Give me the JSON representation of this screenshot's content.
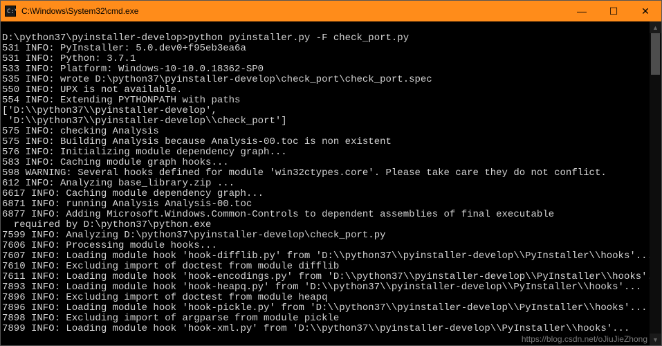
{
  "window": {
    "title": "C:\\Windows\\System32\\cmd.exe",
    "controls": {
      "minimize": "—",
      "maximize": "☐",
      "close": "✕"
    }
  },
  "prompt": "D:\\python37\\pyinstaller-develop>",
  "command": "python pyinstaller.py -F check_port.py",
  "lines": [
    "531 INFO: PyInstaller: 5.0.dev0+f95eb3ea6a",
    "531 INFO: Python: 3.7.1",
    "533 INFO: Platform: Windows-10-10.0.18362-SP0",
    "535 INFO: wrote D:\\python37\\pyinstaller-develop\\check_port\\check_port.spec",
    "550 INFO: UPX is not available.",
    "554 INFO: Extending PYTHONPATH with paths",
    "['D:\\\\python37\\\\pyinstaller-develop',",
    " 'D:\\\\python37\\\\pyinstaller-develop\\\\check_port']",
    "575 INFO: checking Analysis",
    "575 INFO: Building Analysis because Analysis-00.toc is non existent",
    "576 INFO: Initializing module dependency graph...",
    "583 INFO: Caching module graph hooks...",
    "598 WARNING: Several hooks defined for module 'win32ctypes.core'. Please take care they do not conflict.",
    "612 INFO: Analyzing base_library.zip ...",
    "6617 INFO: Caching module dependency graph...",
    "6871 INFO: running Analysis Analysis-00.toc",
    "6877 INFO: Adding Microsoft.Windows.Common-Controls to dependent assemblies of final executable",
    "  required by D:\\python37\\python.exe",
    "7599 INFO: Analyzing D:\\python37\\pyinstaller-develop\\check_port.py",
    "7606 INFO: Processing module hooks...",
    "7607 INFO: Loading module hook 'hook-difflib.py' from 'D:\\\\python37\\\\pyinstaller-develop\\\\PyInstaller\\\\hooks'...",
    "7610 INFO: Excluding import of doctest from module difflib",
    "7611 INFO: Loading module hook 'hook-encodings.py' from 'D:\\\\python37\\\\pyinstaller-develop\\\\PyInstaller\\\\hooks'...",
    "7893 INFO: Loading module hook 'hook-heapq.py' from 'D:\\\\python37\\\\pyinstaller-develop\\\\PyInstaller\\\\hooks'...",
    "7896 INFO: Excluding import of doctest from module heapq",
    "7896 INFO: Loading module hook 'hook-pickle.py' from 'D:\\\\python37\\\\pyinstaller-develop\\\\PyInstaller\\\\hooks'...",
    "7898 INFO: Excluding import of argparse from module pickle",
    "7899 INFO: Loading module hook 'hook-xml.py' from 'D:\\\\python37\\\\pyinstaller-develop\\\\PyInstaller\\\\hooks'..."
  ],
  "watermark": "https://blog.csdn.net/oJiuJieZhong"
}
